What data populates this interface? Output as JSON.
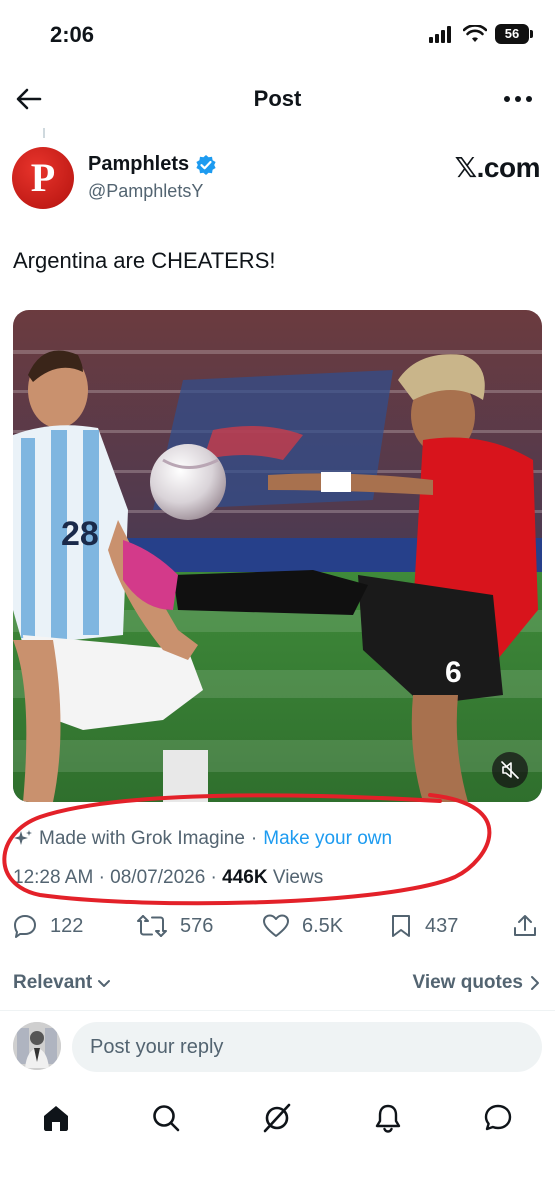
{
  "status_bar": {
    "time": "2:06",
    "battery": "56"
  },
  "header": {
    "title": "Post"
  },
  "post": {
    "author_name": "Pamphlets",
    "author_handle": "@PamphletsY",
    "avatar_letter": "P",
    "source_label": "𝕏.com",
    "text": "Argentina are CHEATERS!",
    "grok_text": "Made with Grok Imagine",
    "grok_separator": "·",
    "grok_link": "Make your own",
    "time": "12:28 AM",
    "date": "08/07/2026",
    "views_count": "446K",
    "views_label": "Views",
    "meta_separator": "·"
  },
  "actions": {
    "replies": "122",
    "reposts": "576",
    "likes": "6.5K",
    "bookmarks": "437"
  },
  "filters": {
    "sort_label": "Relevant",
    "view_quotes_label": "View quotes"
  },
  "reply": {
    "placeholder": "Post your reply"
  },
  "colors": {
    "accent": "#1d9bf0",
    "secondary_text": "#536471",
    "annotation": "#e32129",
    "avatar_red": "#d11f17"
  },
  "icons": {
    "back": "arrow-left-icon",
    "more": "more-horizontal-icon",
    "verified": "verified-badge-icon",
    "sparkle": "sparkle-icon",
    "mute": "speaker-muted-icon",
    "reply": "comment-icon",
    "repost": "repost-icon",
    "like": "heart-icon",
    "bookmark": "bookmark-icon",
    "share": "share-icon",
    "home": "home-icon",
    "search": "search-icon",
    "grok": "grok-icon",
    "notifications": "bell-icon",
    "messages": "message-icon"
  }
}
